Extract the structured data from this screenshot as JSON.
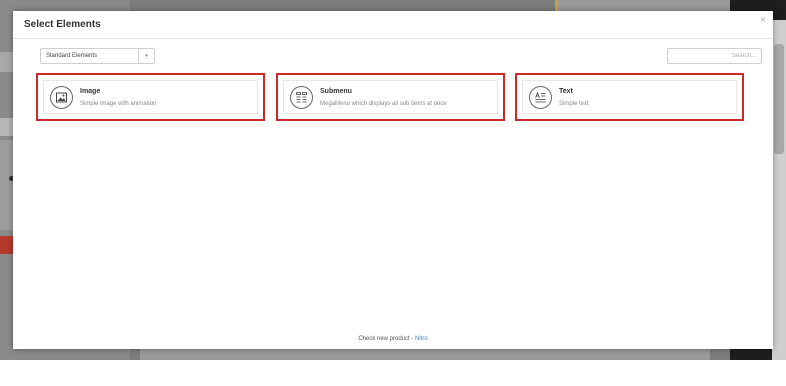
{
  "modal": {
    "title": "Select Elements",
    "close_label": "×",
    "filter": {
      "selected": "Standard Elements",
      "caret": "▾"
    },
    "search": {
      "placeholder": "Search..."
    },
    "elements": [
      {
        "icon": "image-icon",
        "title": "Image",
        "description": "Simple image with animation"
      },
      {
        "icon": "submenu-icon",
        "title": "Submenu",
        "description": "MegaMenu which displays all sub items at once"
      },
      {
        "icon": "text-icon",
        "title": "Text",
        "description": "Simple text"
      }
    ],
    "footer": {
      "text": "Check new product - ",
      "link": "Nitro"
    }
  },
  "colors": {
    "highlight": "#cc2a2a",
    "link": "#3b7bc4",
    "background_dim": "#7d7d7d",
    "sidebar": "#1e1e1e"
  }
}
